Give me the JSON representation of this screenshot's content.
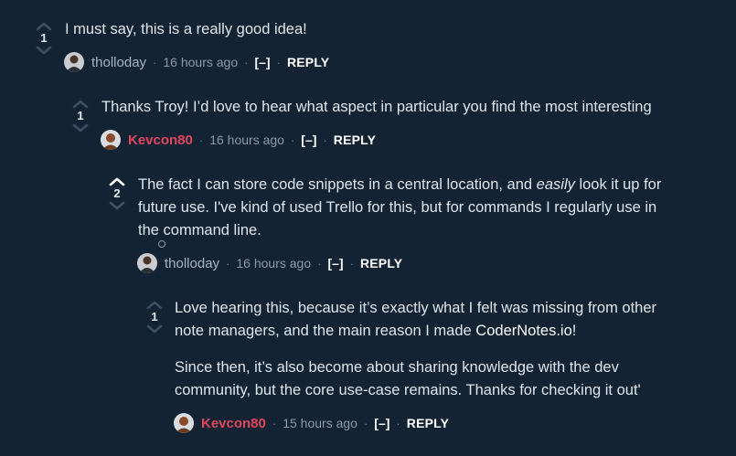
{
  "thread": {
    "comments": [
      {
        "score": "1",
        "paragraphs": [
          "I must say, this is a really good idea!"
        ],
        "author": "tholloday",
        "time": "16 hours ago",
        "collapse": "[–]",
        "reply": "REPLY",
        "dot": "·",
        "vote_up_active": false,
        "author_highlight": false
      },
      {
        "score": "1",
        "paragraphs": [
          "Thanks Troy! I’d love to hear what aspect in particular you find the most interesting"
        ],
        "author": "Kevcon80",
        "time": "16 hours ago",
        "collapse": "[–]",
        "reply": "REPLY",
        "dot": "·",
        "vote_up_active": false,
        "author_highlight": true
      },
      {
        "score": "2",
        "line1_a": "The fact I can store code snippets in a central location, and ",
        "line1_em": "easily",
        "line1_b": " look it up for",
        "line2": "future use. I've kind of used Trello for this, but for commands I regularly use in",
        "line3": "the command line.",
        "author": "tholloday",
        "time": "16 hours ago",
        "collapse": "[–]",
        "reply": "REPLY",
        "dot": "·",
        "vote_up_active": true,
        "author_highlight": false
      },
      {
        "score": "1",
        "p1_line1": "Love hearing this, because it’s exactly what I felt was missing from other",
        "p1_line2_a": "note managers, and the main reason I made ",
        "p1_link": "CoderNotes.io",
        "p1_line2_b": "!",
        "p2_line1": "Since then, it’s also become about sharing knowledge with the dev",
        "p2_line2": "community, but the core use-case remains. Thanks for checking it out'",
        "author": "Kevcon80",
        "time": "15 hours ago",
        "collapse": "[–]",
        "reply": "REPLY",
        "dot": "·",
        "vote_up_active": false,
        "author_highlight": true
      }
    ]
  },
  "colors": {
    "background": "#142334",
    "op_author": "#e0475f",
    "text": "#dfe5ec",
    "muted": "#8a98a8",
    "arrow_idle": "#3d4f63",
    "arrow_active": "#ffffff"
  },
  "icons": {
    "upvote": "upvote-arrow-icon",
    "downvote": "downvote-arrow-icon",
    "avatar_tholloday": "tholloday-avatar",
    "avatar_kevcon": "kevcon80-avatar"
  }
}
